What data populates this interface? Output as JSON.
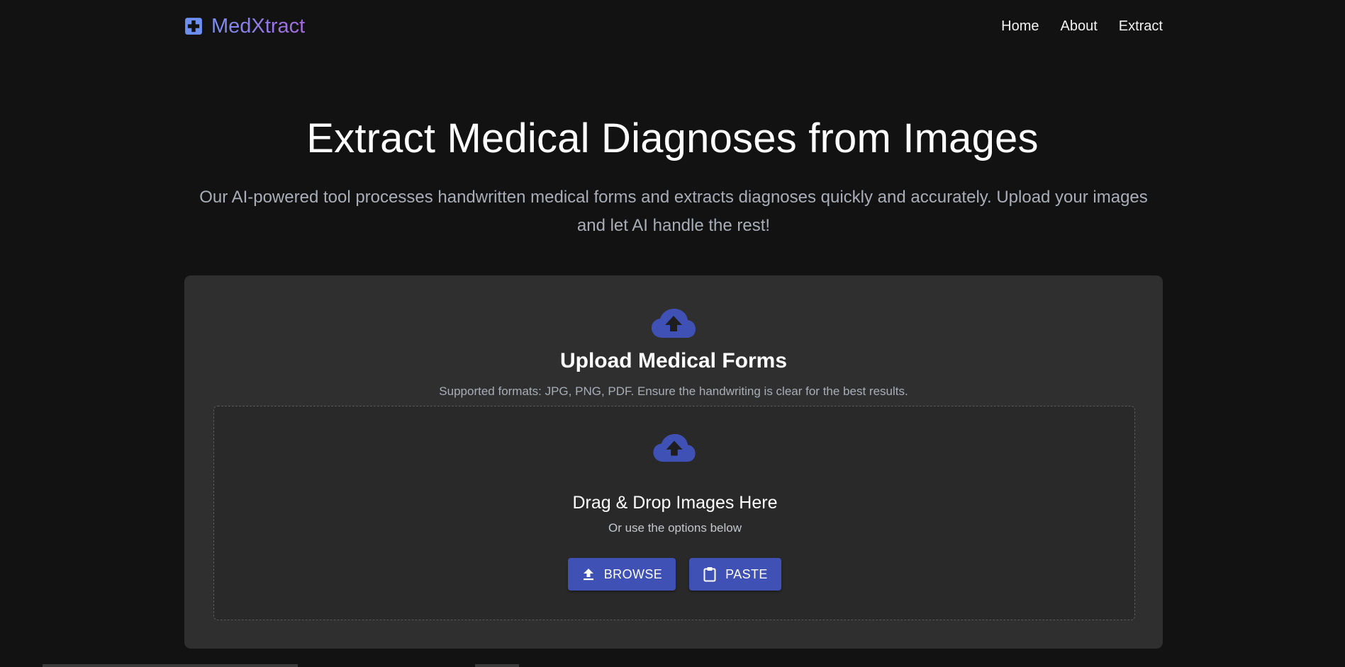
{
  "brand": {
    "name": "MedXtract",
    "icon": "medical-cross-icon"
  },
  "nav": {
    "links": [
      "Home",
      "About",
      "Extract"
    ]
  },
  "hero": {
    "title": "Extract Medical Diagnoses from Images",
    "subtitle": "Our AI-powered tool processes handwritten medical forms and extracts diagnoses quickly and accurately. Upload your images and let AI handle the rest!"
  },
  "upload": {
    "icon": "cloud-upload-icon",
    "title": "Upload Medical Forms",
    "formats": "Supported formats: JPG, PNG, PDF. Ensure the handwriting is clear for the best results.",
    "dropzone": {
      "icon": "cloud-upload-icon",
      "title": "Drag & Drop Images Here",
      "subtitle": "Or use the options below"
    },
    "buttons": {
      "browse": {
        "label": "BROWSE",
        "icon": "upload-arrow-icon"
      },
      "paste": {
        "label": "PASTE",
        "icon": "clipboard-icon"
      }
    }
  },
  "colors": {
    "background": "#121212",
    "card": "#2f2f2f",
    "dropzone": "#292929",
    "accent": "#3f51b5",
    "brand_icon": "#6d8ff0",
    "muted_text": "#a9adb7"
  }
}
